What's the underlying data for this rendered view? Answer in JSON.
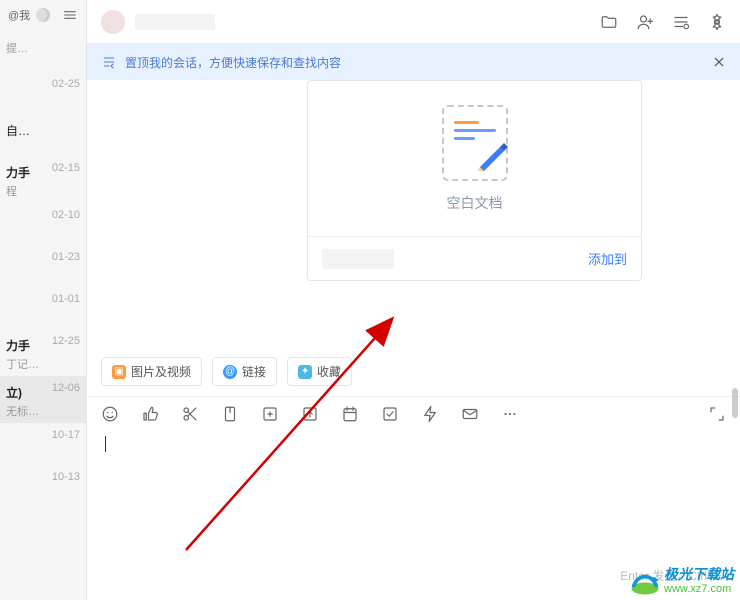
{
  "sidebar": {
    "at_me": "@我",
    "items": [
      {
        "title": "",
        "sub": "提…",
        "date": ""
      },
      {
        "title": "",
        "sub": "",
        "date": "02-25"
      },
      {
        "title": "自…",
        "sub": "",
        "date": ""
      },
      {
        "title": "力手",
        "sub": "程",
        "date": "02-15",
        "bold": true
      },
      {
        "title": "",
        "sub": "",
        "date": "02-10"
      },
      {
        "title": "",
        "sub": "",
        "date": "01-23"
      },
      {
        "title": "",
        "sub": "",
        "date": "01-01"
      },
      {
        "title": "力手",
        "sub": "丁记…",
        "date": "12-25",
        "bold": true
      },
      {
        "title": "立)",
        "sub": "无标…",
        "date": "12-06",
        "bold": true,
        "selected": true
      },
      {
        "title": "",
        "sub": "",
        "date": "10-17"
      },
      {
        "title": "",
        "sub": "",
        "date": "10-13"
      }
    ]
  },
  "banner": {
    "text": "置顶我的会话，方便快速保存和查找内容"
  },
  "doc_card": {
    "label": "空白文档",
    "add_to": "添加到"
  },
  "chips": {
    "media": "图片及视频",
    "link": "链接",
    "fav": "收藏"
  },
  "input": {
    "hint": "Enter 发送，Ctrl+E"
  },
  "watermark": {
    "name": "极光下载站",
    "url": "www.xz7.com"
  }
}
